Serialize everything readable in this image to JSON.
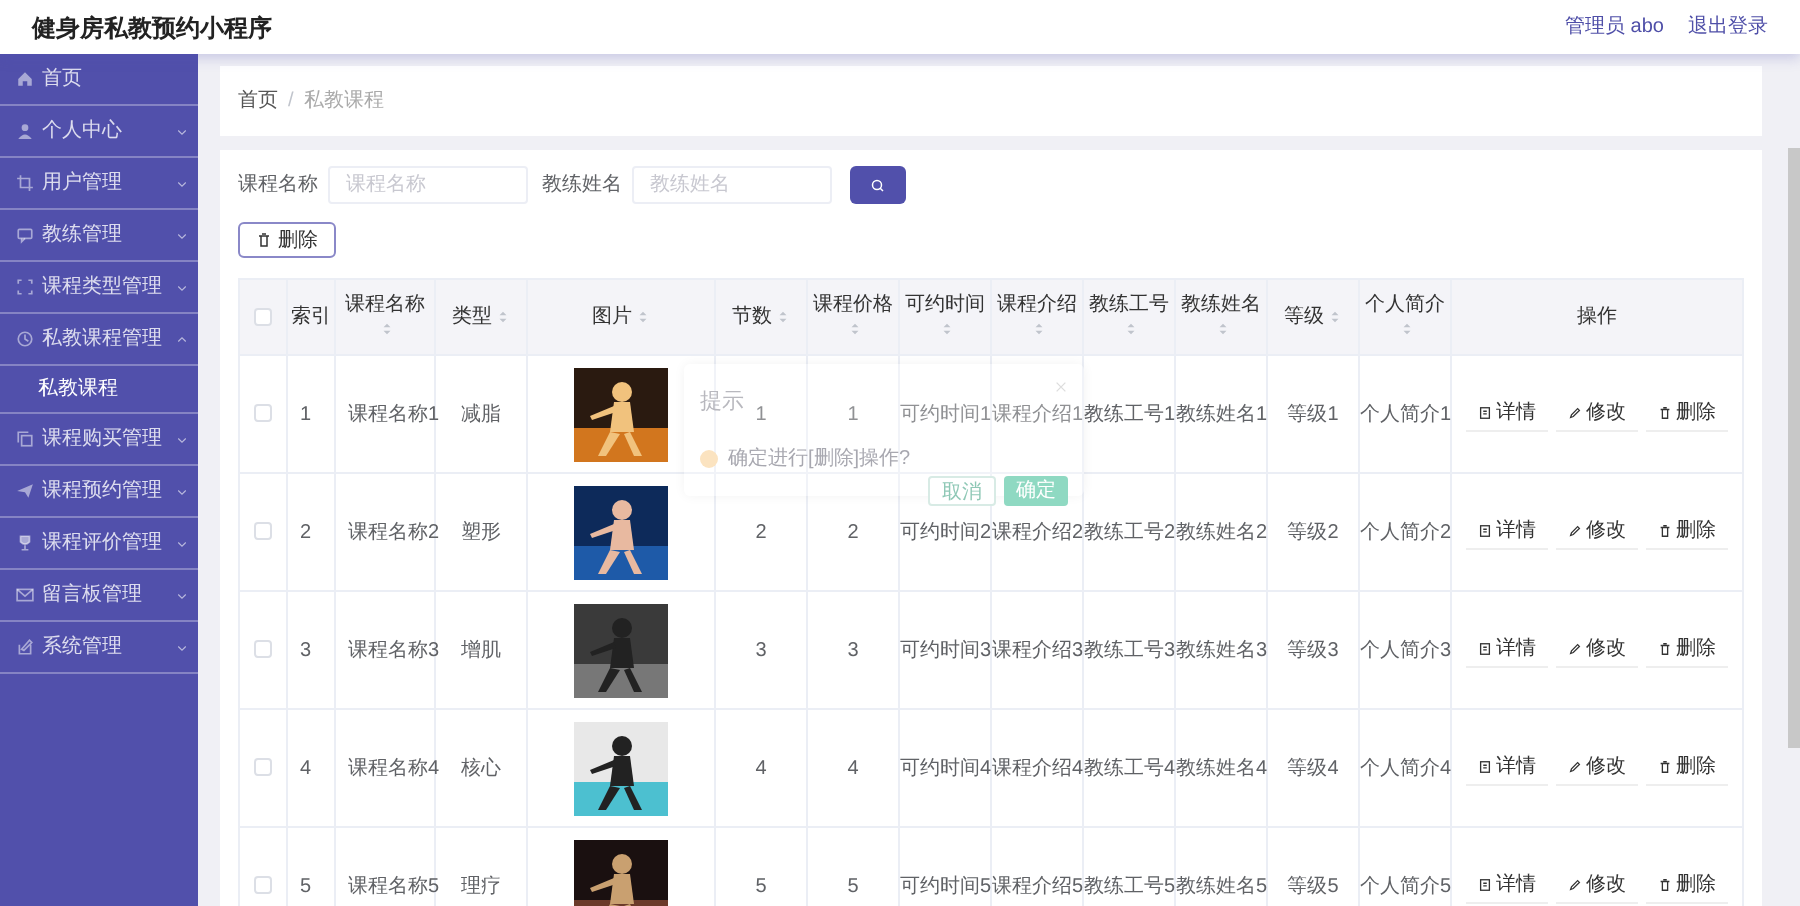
{
  "header": {
    "title": "健身房私教预约小程序",
    "user": "管理员 abo",
    "logout": "退出登录"
  },
  "sidebar": {
    "items": [
      {
        "kind": "link",
        "label": "首页"
      },
      {
        "kind": "menu",
        "label": "个人中心",
        "expanded": false
      },
      {
        "kind": "menu",
        "label": "用户管理",
        "expanded": false
      },
      {
        "kind": "menu",
        "label": "教练管理",
        "expanded": false
      },
      {
        "kind": "menu",
        "label": "课程类型管理",
        "expanded": false
      },
      {
        "kind": "menu",
        "label": "私教课程管理",
        "expanded": true,
        "children": [
          {
            "label": "私教课程"
          }
        ]
      },
      {
        "kind": "menu",
        "label": "课程购买管理",
        "expanded": false
      },
      {
        "kind": "menu",
        "label": "课程预约管理",
        "expanded": false
      },
      {
        "kind": "menu",
        "label": "课程评价管理",
        "expanded": false
      },
      {
        "kind": "menu",
        "label": "留言板管理",
        "expanded": false
      },
      {
        "kind": "menu",
        "label": "系统管理",
        "expanded": false
      }
    ]
  },
  "breadcrumb": {
    "separator": "/",
    "items": [
      "首页",
      "私教课程"
    ]
  },
  "search": {
    "fields": [
      {
        "label": "课程名称",
        "placeholder": "课程名称"
      },
      {
        "label": "教练姓名",
        "placeholder": "教练姓名"
      }
    ]
  },
  "delete_button": "删除",
  "table": {
    "header_checked": false,
    "columns": [
      {
        "label": "索引",
        "sortable": false
      },
      {
        "label": "课程名称",
        "sortable": true
      },
      {
        "label": "类型",
        "sortable": true
      },
      {
        "label": "图片",
        "sortable": true
      },
      {
        "label": "节数",
        "sortable": true
      },
      {
        "label": "课程价格",
        "sortable": true
      },
      {
        "label": "可约时间",
        "sortable": true
      },
      {
        "label": "课程介绍",
        "sortable": true
      },
      {
        "label": "教练工号",
        "sortable": true
      },
      {
        "label": "教练姓名",
        "sortable": true
      },
      {
        "label": "等级",
        "sortable": true
      },
      {
        "label": "个人简介",
        "sortable": true
      },
      {
        "label": "操作",
        "sortable": false
      }
    ],
    "rows": [
      {
        "checked": false,
        "cells": [
          "1",
          "课程名称1",
          "减脂",
          {
            "kind": "picture"
          },
          "1",
          "1",
          "可约时间1",
          "课程介绍1",
          "教练工号1",
          "教练姓名1",
          "等级1",
          "个人简介1"
        ],
        "actions": [
          "详情",
          "修改",
          "删除"
        ]
      },
      {
        "checked": false,
        "cells": [
          "2",
          "课程名称2",
          "塑形",
          {
            "kind": "picture"
          },
          "2",
          "2",
          "可约时间2",
          "课程介绍2",
          "教练工号2",
          "教练姓名2",
          "等级2",
          "个人简介2"
        ],
        "actions": [
          "详情",
          "修改",
          "删除"
        ]
      },
      {
        "checked": false,
        "cells": [
          "3",
          "课程名称3",
          "增肌",
          {
            "kind": "picture"
          },
          "3",
          "3",
          "可约时间3",
          "课程介绍3",
          "教练工号3",
          "教练姓名3",
          "等级3",
          "个人简介3"
        ],
        "actions": [
          "详情",
          "修改",
          "删除"
        ]
      },
      {
        "checked": false,
        "cells": [
          "4",
          "课程名称4",
          "核心",
          {
            "kind": "picture"
          },
          "4",
          "4",
          "可约时间4",
          "课程介绍4",
          "教练工号4",
          "教练姓名4",
          "等级4",
          "个人简介4"
        ],
        "actions": [
          "详情",
          "修改",
          "删除"
        ]
      },
      {
        "checked": false,
        "cells": [
          "5",
          "课程名称5",
          "理疗",
          {
            "kind": "picture"
          },
          "5",
          "5",
          "可约时间5",
          "课程介绍5",
          "教练工号5",
          "教练姓名5",
          "等级5",
          "个人简介5"
        ],
        "actions": [
          "详情",
          "修改",
          "删除"
        ]
      }
    ]
  },
  "dialog": {
    "title": "提示",
    "message": "确定进行[删除]操作?",
    "buttons": [
      {
        "kind": "cancel",
        "label": "取消"
      },
      {
        "kind": "confirm",
        "label": "确定"
      }
    ]
  }
}
